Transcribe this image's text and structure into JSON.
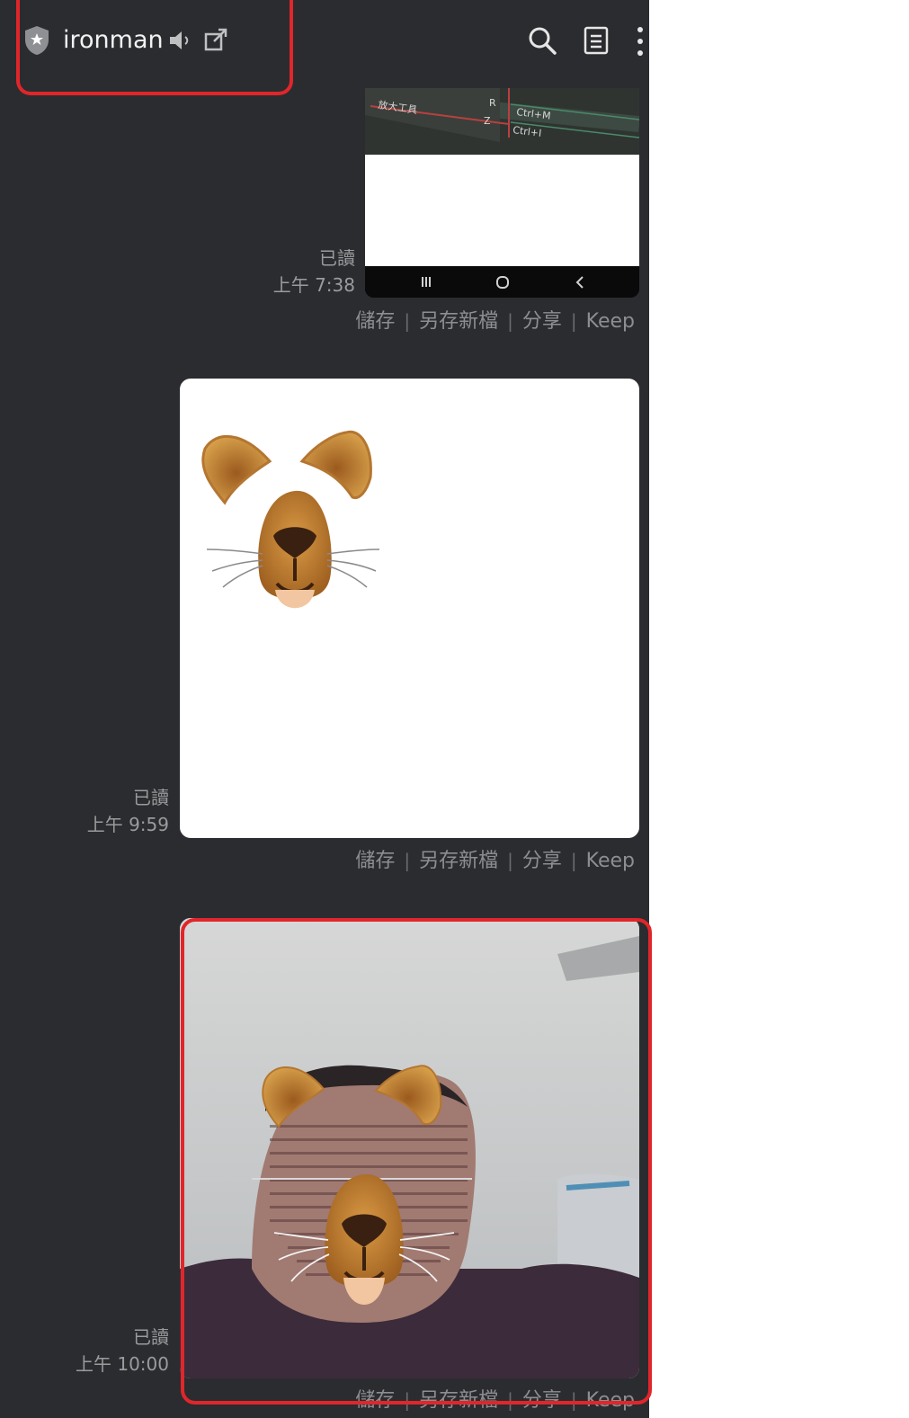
{
  "header": {
    "title": "ironman",
    "icons": [
      "shield-star-icon",
      "mute-speaker-icon",
      "external-window-icon",
      "search-icon",
      "notes-icon",
      "more-icon"
    ]
  },
  "image1": {
    "keyboard_text": [
      "放大工具",
      "R",
      "Ctrl+M",
      "Z",
      "Ctrl+I"
    ]
  },
  "messages": [
    {
      "read": "已讀",
      "time": "上午 7:38"
    },
    {
      "read": "已讀",
      "time": "上午 9:59"
    },
    {
      "read": "已讀",
      "time": "上午 10:00"
    }
  ],
  "actions": {
    "save": "儲存",
    "save_as": "另存新檔",
    "share": "分享",
    "keep": "Keep",
    "separator": "|"
  },
  "colors": {
    "panel_bg": "#2b2c2f",
    "highlight": "#e0262b",
    "meta_text": "#9a9b9d"
  }
}
